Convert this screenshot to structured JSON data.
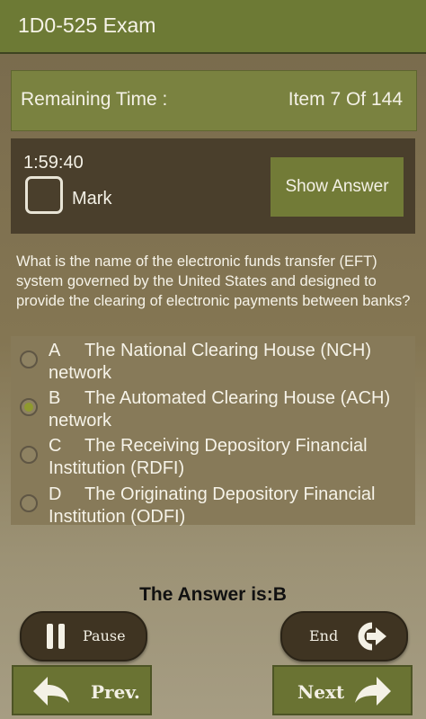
{
  "header": {
    "title": "1D0-525 Exam"
  },
  "info": {
    "remaining_label": "Remaining Time :",
    "item_counter": "Item 7 Of 144"
  },
  "panel": {
    "timer": "1:59:40",
    "mark_label": "Mark",
    "show_answer_label": "Show Answer"
  },
  "question": {
    "text": "What is the name of the electronic funds transfer (EFT) system governed by the United States and designed to provide the clearing of electronic payments between banks?",
    "options": [
      {
        "letter": "A",
        "text": "The National Clearing House (NCH) network",
        "selected": false
      },
      {
        "letter": "B",
        "text": "The Automated Clearing House (ACH) network",
        "selected": true
      },
      {
        "letter": "C",
        "text": "The Receiving Depository Financial Institution (RDFI)",
        "selected": false
      },
      {
        "letter": "D",
        "text": "The Originating Depository Financial Institution (ODFI)",
        "selected": false
      }
    ]
  },
  "answer_text": "The Answer is:B",
  "controls": {
    "pause_label": "Pause",
    "end_label": "End",
    "prev_label": "Prev.",
    "next_label": "Next"
  },
  "icons": {
    "pause": "pause-icon",
    "end": "exit-icon",
    "prev": "back-arrow-icon",
    "next": "forward-arrow-icon"
  },
  "colors": {
    "title_bar": "#6d7a35",
    "panel": "#4a3f2c",
    "button": "#727b37"
  }
}
